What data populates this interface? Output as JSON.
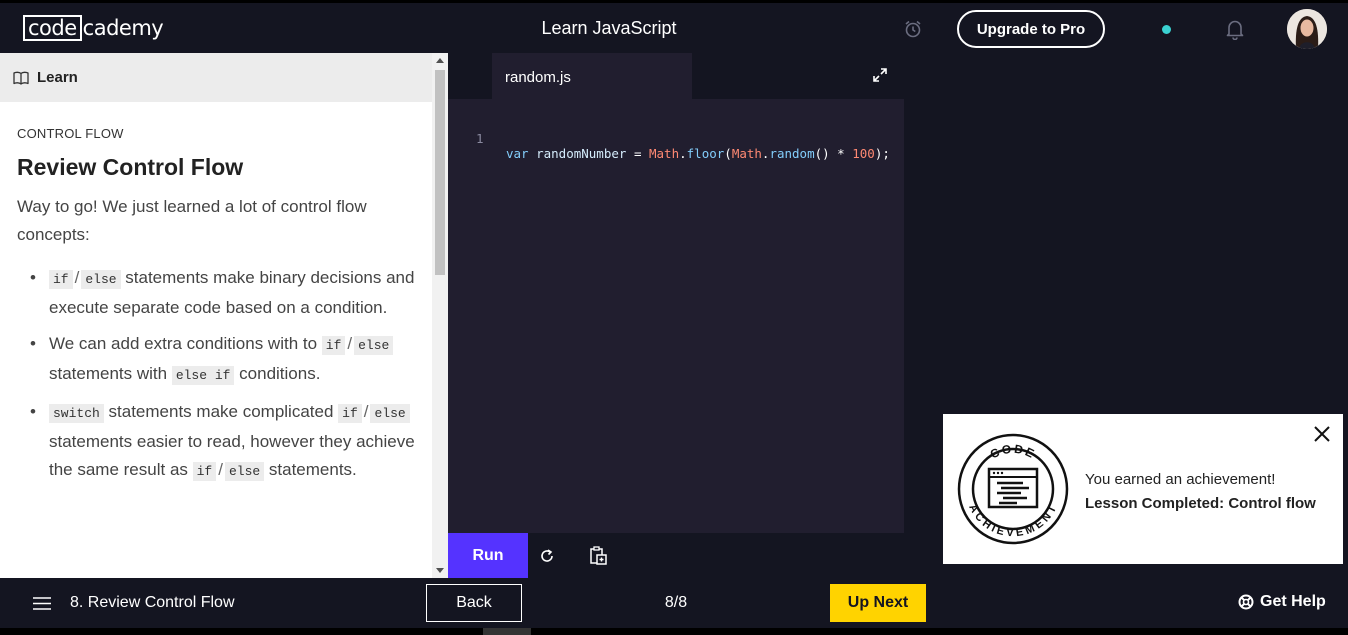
{
  "header": {
    "logo_box": "code",
    "logo_rest": "cademy",
    "course_title": "Learn JavaScript",
    "upgrade_label": "Upgrade to Pro"
  },
  "left_panel": {
    "learn_label": "Learn",
    "eyebrow": "CONTROL FLOW",
    "title": "Review Control Flow",
    "intro": "Way to go! We just learned a lot of control flow concepts:",
    "bullets": {
      "b1": {
        "code1": "if",
        "slash": "/",
        "code2": "else",
        "text": " statements make binary decisions and execute separate code based on a condition."
      },
      "b2": {
        "text1": "We can add extra conditions with to ",
        "code1": "if",
        "slash": "/",
        "code2": "else",
        "text2": " statements with ",
        "code3": "else if",
        "text3": " conditions."
      },
      "b3": {
        "code0": "switch",
        "text1": " statements make complicated ",
        "code1": "if",
        "slash": "/",
        "code2": "else",
        "text2": " statements easier to read, however they achieve the same result as ",
        "code3": "if",
        "slash2": "/",
        "code4": "else",
        "text3": " statements."
      }
    }
  },
  "editor": {
    "tab_label": "random.js",
    "line_number": "1",
    "code_tokens": {
      "t1": "var",
      "t2": " randomNumber ",
      "t3": "=",
      "t4": " ",
      "t5": "Math",
      "t6": ".",
      "t7": "floor",
      "t8": "(",
      "t9": "Math",
      "t10": ".",
      "t11": "random",
      "t12": "() * ",
      "t13": "100",
      "t14": ");"
    },
    "run_label": "Run"
  },
  "toast": {
    "line1": "You earned an achievement!",
    "line2": "Lesson Completed: Control flow",
    "badge_top": "CODE",
    "badge_bottom": "ACHIEVEMENT"
  },
  "footer": {
    "lesson_name": "8. Review Control Flow",
    "back_label": "Back",
    "progress": "8/8",
    "next_label": "Up Next",
    "help_label": "Get Help"
  },
  "colors": {
    "run_button": "#5533ff",
    "up_next": "#ffd300",
    "status_dot": "#3ad1d1",
    "background": "#141521",
    "editor": "#211e2f"
  }
}
